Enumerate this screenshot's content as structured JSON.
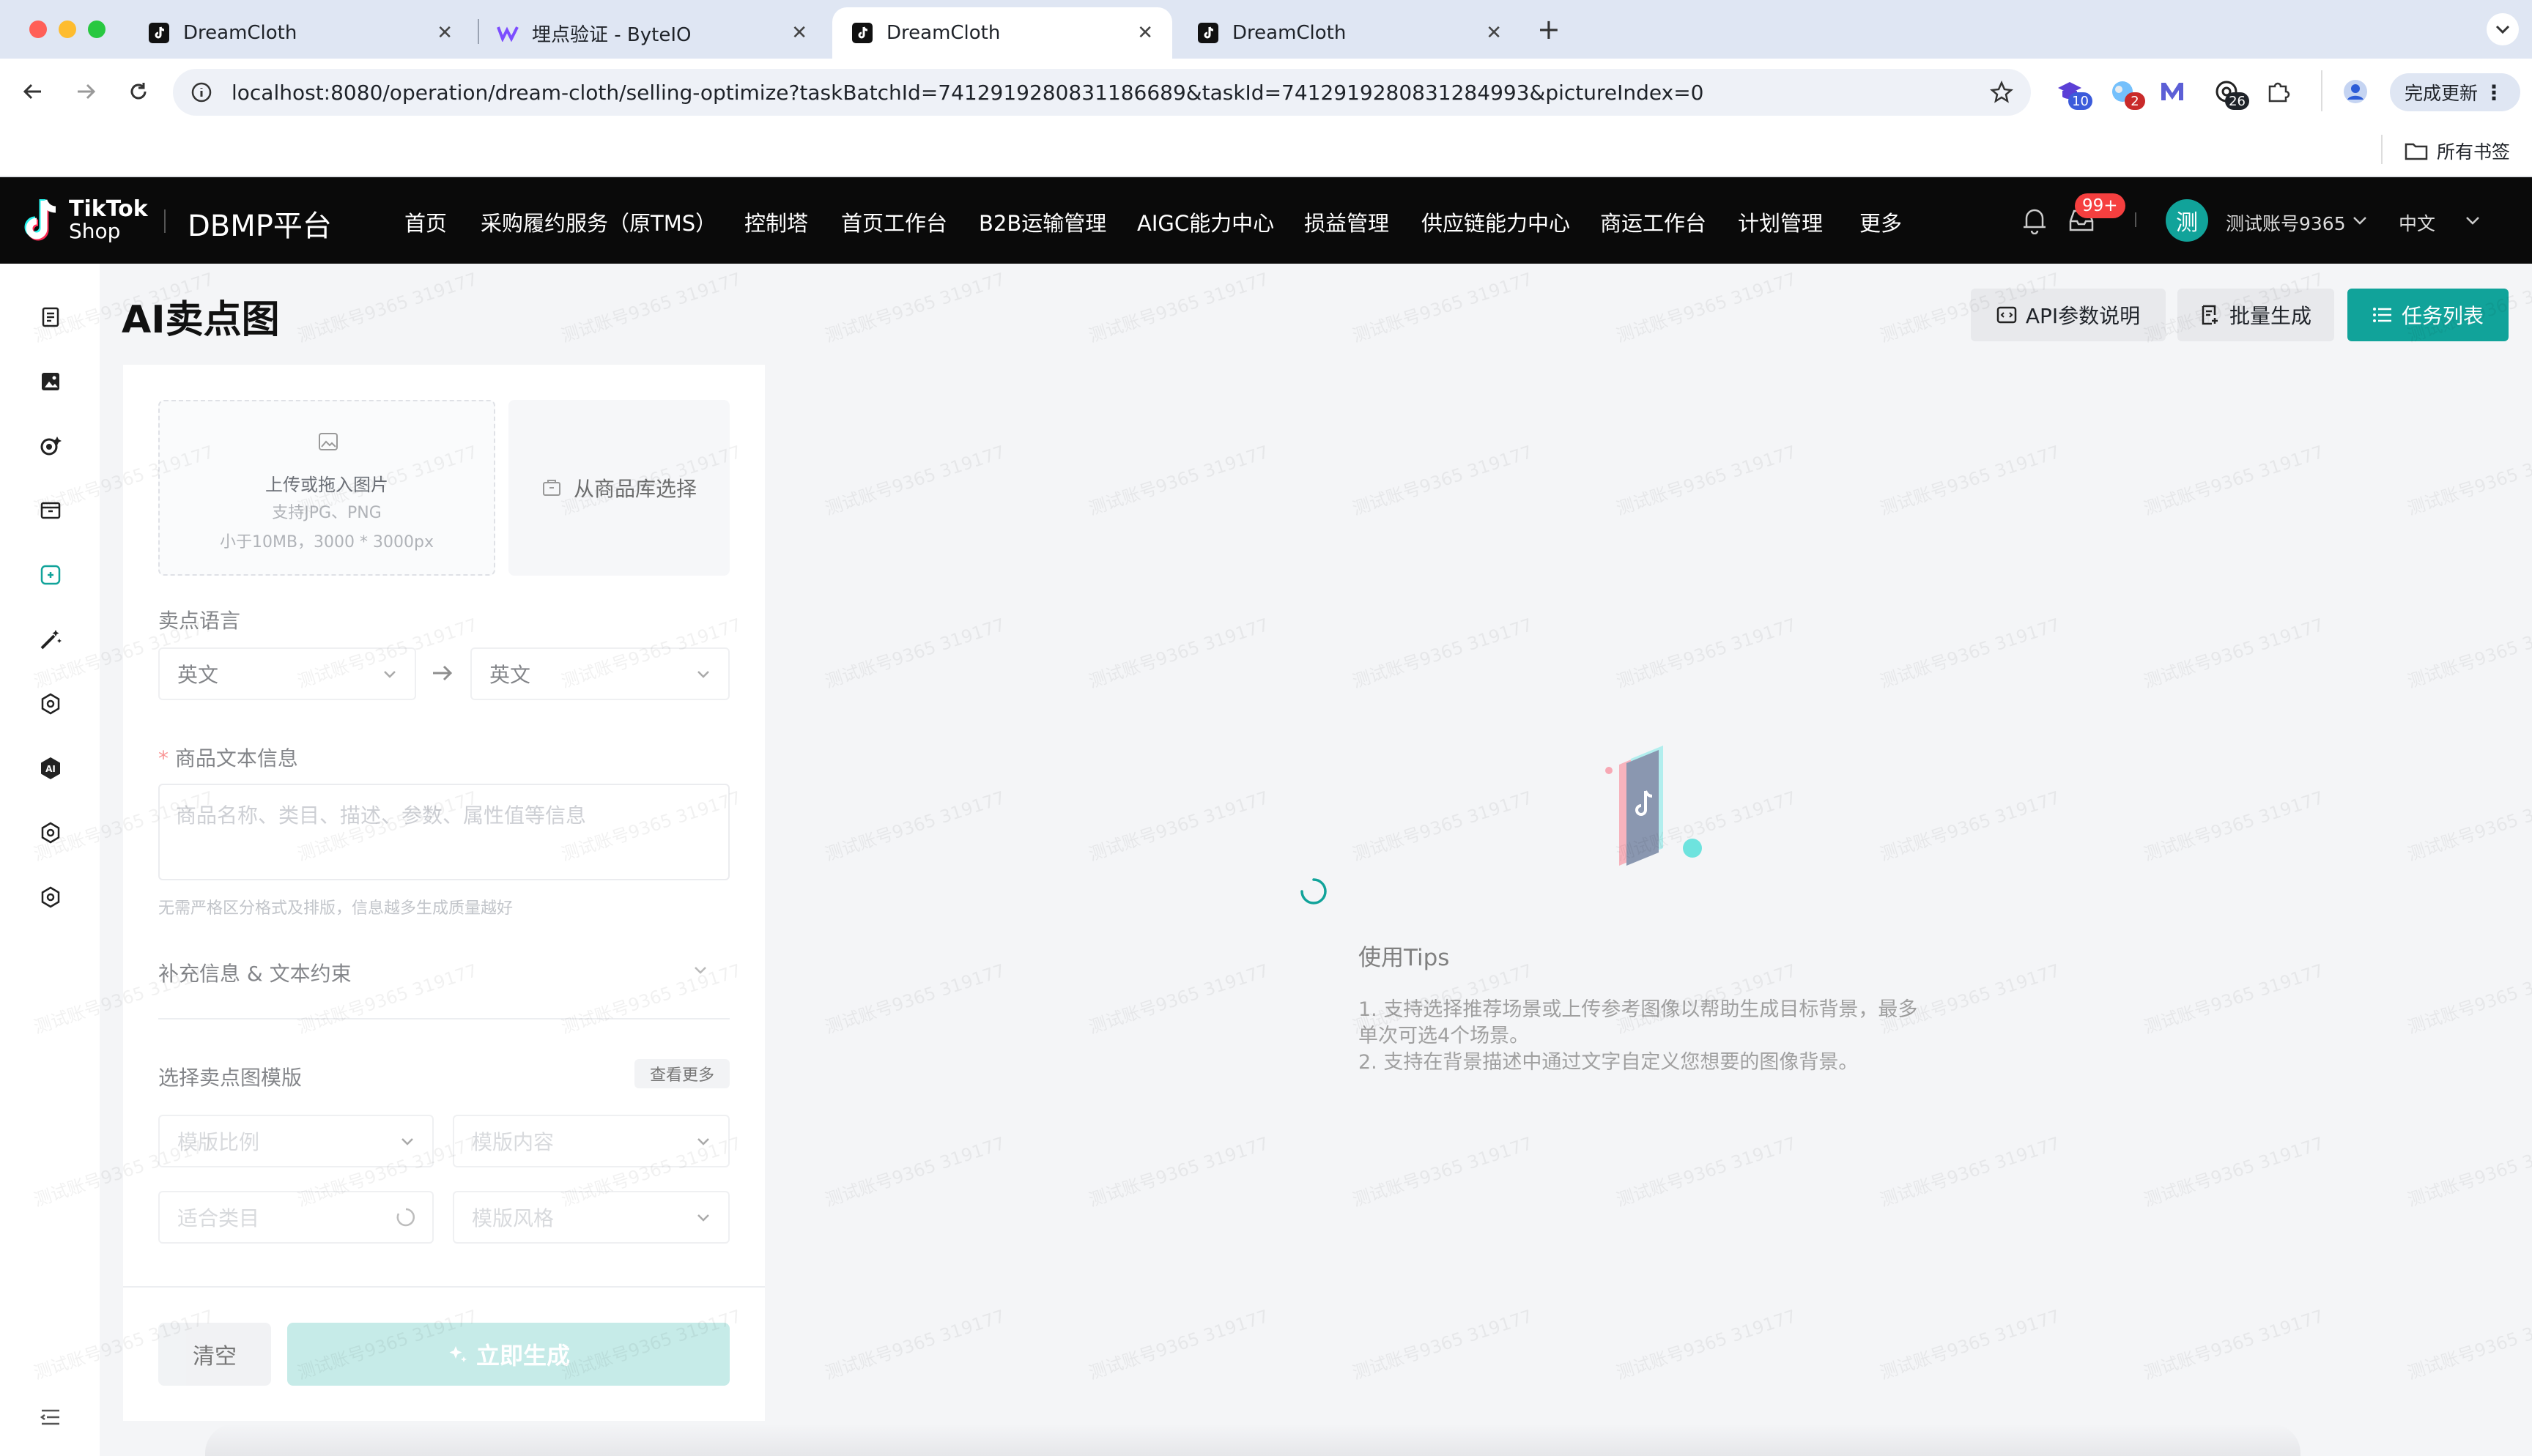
{
  "browser": {
    "tabs": [
      {
        "title": "DreamCloth",
        "active": false
      },
      {
        "title": "埋点验证 - ByteIO",
        "active": false
      },
      {
        "title": "DreamCloth",
        "active": true
      },
      {
        "title": "DreamCloth",
        "active": false
      }
    ],
    "url": "localhost:8080/operation/dream-cloth/selling-optimize?taskBatchId=7412919280831186689&taskId=7412919280831284993&pictureIndex=0",
    "extensions": [
      {
        "icon": "graduation-cap-icon",
        "badge": "10",
        "badge_color": "#3b5bdb"
      },
      {
        "icon": "globe-icon",
        "badge": "2",
        "badge_color": "#c92a2a"
      },
      {
        "icon": "m-logo-icon",
        "badge": "",
        "badge_color": ""
      },
      {
        "icon": "openai-icon",
        "badge": "26",
        "badge_color": "#1f2329"
      },
      {
        "icon": "puzzle-icon",
        "badge": "",
        "badge_color": ""
      }
    ],
    "update_label": "完成更新",
    "bookmarks_label": "所有书签"
  },
  "app": {
    "logo_line1": "TikTok",
    "logo_line2": "Shop",
    "platform": "DBMP平台",
    "nav": [
      "首页",
      "采购履约服务（原TMS）",
      "控制塔",
      "首页工作台",
      "B2B运输管理",
      "AIGC能力中心",
      "损益管理",
      "供应链能力中心",
      "商运工作台",
      "计划管理",
      "更多"
    ],
    "notification_badge": "99+",
    "avatar_char": "测",
    "user_name": "测试账号9365",
    "language": "中文"
  },
  "page": {
    "title": "AI卖点图",
    "buttons": {
      "api": "API参数说明",
      "batch": "批量生成",
      "tasks": "任务列表"
    },
    "watermark": "测试账号9365 319177"
  },
  "form": {
    "upload_title": "上传或拖入图片",
    "upload_formats": "支持JPG、PNG",
    "upload_limits": "小于10MB，3000 * 3000px",
    "from_library": "从商品库选择",
    "lang_label": "卖点语言",
    "lang_from": "英文",
    "lang_to": "英文",
    "required_mark": "*",
    "product_text_label": "商品文本信息",
    "product_text_placeholder": "商品名称、类目、描述、参数、属性值等信息",
    "product_text_hint": "无需严格区分格式及排版，信息越多生成质量越好",
    "supplement_label": "补充信息 & 文本约束",
    "template_label": "选择卖点图模版",
    "see_more": "查看更多",
    "ratio_placeholder": "模版比例",
    "content_placeholder": "模版内容",
    "category_placeholder": "适合类目",
    "style_placeholder": "模版风格",
    "clear_button": "清空",
    "generate_button": "立即生成"
  },
  "tips": {
    "title": "使用Tips",
    "line1a": "1. 支持选择推荐场景或上传参考图像以帮助生成目标背景，最多",
    "line1b": "单次可选4个场景。",
    "line2": "2. 支持在背景描述中通过文字自定义您想要的图像背景。"
  },
  "colors": {
    "accent": "#11a39a",
    "header_bg": "#0a0a0a",
    "badge_red": "#f53f3f"
  }
}
